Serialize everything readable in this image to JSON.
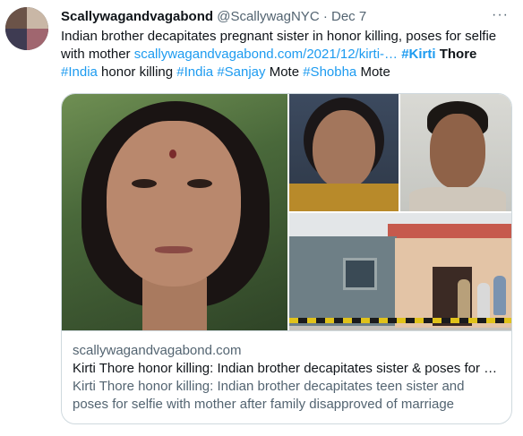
{
  "tweet": {
    "author_name": "Scallywagandvagabond",
    "author_handle": "@ScallywagNYC",
    "dot": "·",
    "date": "Dec 7",
    "more_icon": "···",
    "text": {
      "lead": "Indian brother decapitates pregnant sister in honor killing, poses for selfie with mother ",
      "url": "scallywagandvagabond.com/2021/12/kirti-…",
      "hashtag1": "#Kirti",
      "word1": " Thore",
      "hashtag2": "#India",
      "word2": " honor killing ",
      "hashtag3": "#India",
      "hashtag4": "#Sanjay",
      "word3": " Mote ",
      "hashtag5": "#Shobha",
      "word4": " Mote"
    }
  },
  "card": {
    "domain": "scallywagandvagabond.com",
    "title": "Kirti Thore honor killing: Indian brother decapitates sister & poses for …",
    "description": "Kirti Thore honor killing: Indian brother decapitates teen sister and poses for selfie with mother after family disapproved of marriage"
  }
}
